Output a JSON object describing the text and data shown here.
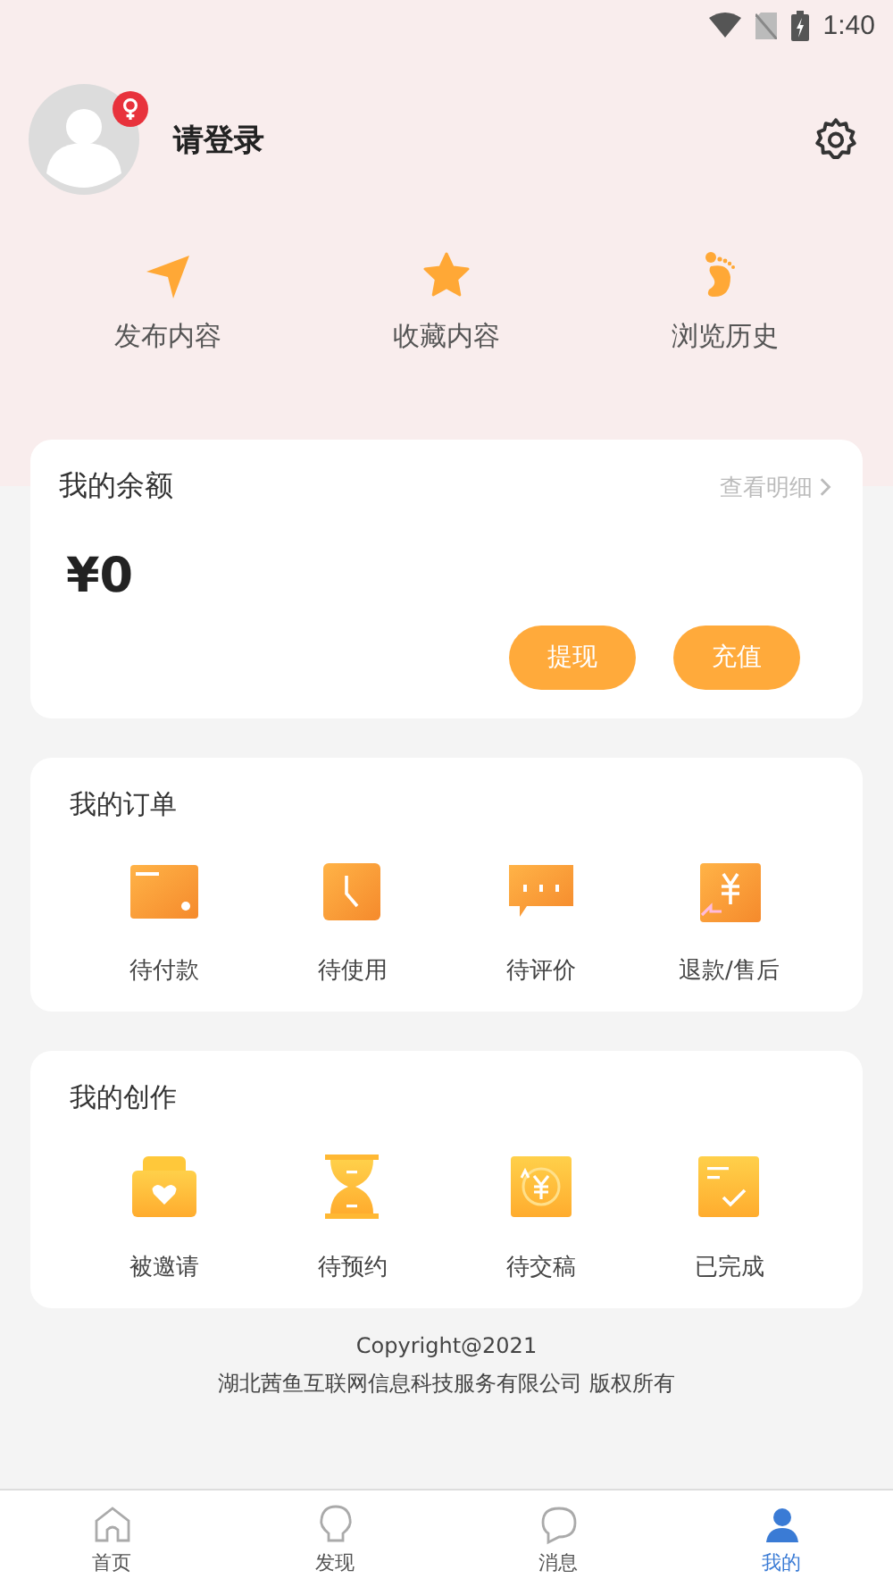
{
  "status_bar": {
    "time": "1:40"
  },
  "profile": {
    "name": "请登录",
    "female": true
  },
  "shortcuts": [
    {
      "kind": "send",
      "label": "发布内容"
    },
    {
      "kind": "star",
      "label": "收藏内容"
    },
    {
      "kind": "foot",
      "label": "浏览历史"
    }
  ],
  "balance": {
    "title": "我的余额",
    "link": "查看明细",
    "amount": "¥0",
    "buttons": [
      "提现",
      "充值"
    ]
  },
  "orders": {
    "title": "我的订单",
    "items": [
      {
        "kind": "wallet",
        "label": "待付款"
      },
      {
        "kind": "clock",
        "label": "待使用"
      },
      {
        "kind": "comment",
        "label": "待评价"
      },
      {
        "kind": "refund",
        "label": "退款/售后"
      }
    ]
  },
  "creation": {
    "title": "我的创作",
    "items": [
      {
        "kind": "invite",
        "label": "被邀请"
      },
      {
        "kind": "hourglass",
        "label": "待预约"
      },
      {
        "kind": "coin",
        "label": "待交稿"
      },
      {
        "kind": "done",
        "label": "已完成"
      }
    ]
  },
  "footer": [
    "Copyright@2021",
    "湖北茜鱼互联网信息科技服务有限公司 版权所有"
  ],
  "tabs": [
    {
      "kind": "home",
      "label": "首页",
      "selected": false
    },
    {
      "kind": "bulb",
      "label": "发现",
      "selected": false
    },
    {
      "kind": "chat",
      "label": "消息",
      "selected": false
    },
    {
      "kind": "user",
      "label": "我的",
      "selected": true
    }
  ]
}
